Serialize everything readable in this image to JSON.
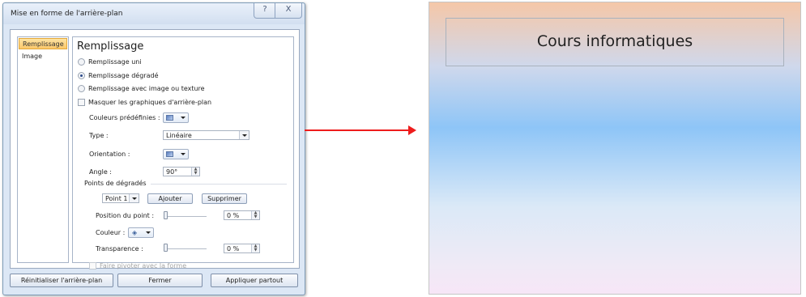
{
  "dialog": {
    "title": "Mise en forme de l'arrière-plan",
    "help_glyph": "?",
    "close_glyph": "X",
    "nav": {
      "items": [
        {
          "label": "Remplissage",
          "selected": true
        },
        {
          "label": "Image",
          "selected": false
        }
      ]
    },
    "panel": {
      "heading": "Remplissage",
      "fill_options": [
        {
          "label": "Remplissage uni",
          "selected": false
        },
        {
          "label": "Remplissage dégradé",
          "selected": true
        },
        {
          "label": "Remplissage avec image ou texture",
          "selected": false
        }
      ],
      "hide_background": {
        "label": "Masquer les graphiques d'arrière-plan",
        "checked": false
      },
      "preset_colors_label": "Couleurs prédéfinies :",
      "type_label": "Type :",
      "type_value": "Linéaire",
      "orientation_label": "Orientation :",
      "angle_label": "Angle :",
      "angle_value": "90°",
      "gradient_stops_label": "Points de dégradés",
      "stop_value": "Point 1",
      "add_label": "Ajouter",
      "remove_label": "Supprimer",
      "position_label": "Position du point :",
      "position_value": "0 %",
      "color_label": "Couleur :",
      "transparency_label": "Transparence :",
      "transparency_value": "0 %",
      "rotate_with_shape": {
        "label": "Faire pivoter avec la forme",
        "checked": false,
        "disabled": true
      }
    },
    "buttons": {
      "reset": "Réinitialiser l'arrière-plan",
      "close": "Fermer",
      "apply_all": "Appliquer partout"
    }
  },
  "slide": {
    "title": "Cours informatiques",
    "gradient_colors": [
      "#f5c7a8",
      "#8ec5f7",
      "#f7e6f7"
    ]
  },
  "arrow_color": "#ee1c1c"
}
